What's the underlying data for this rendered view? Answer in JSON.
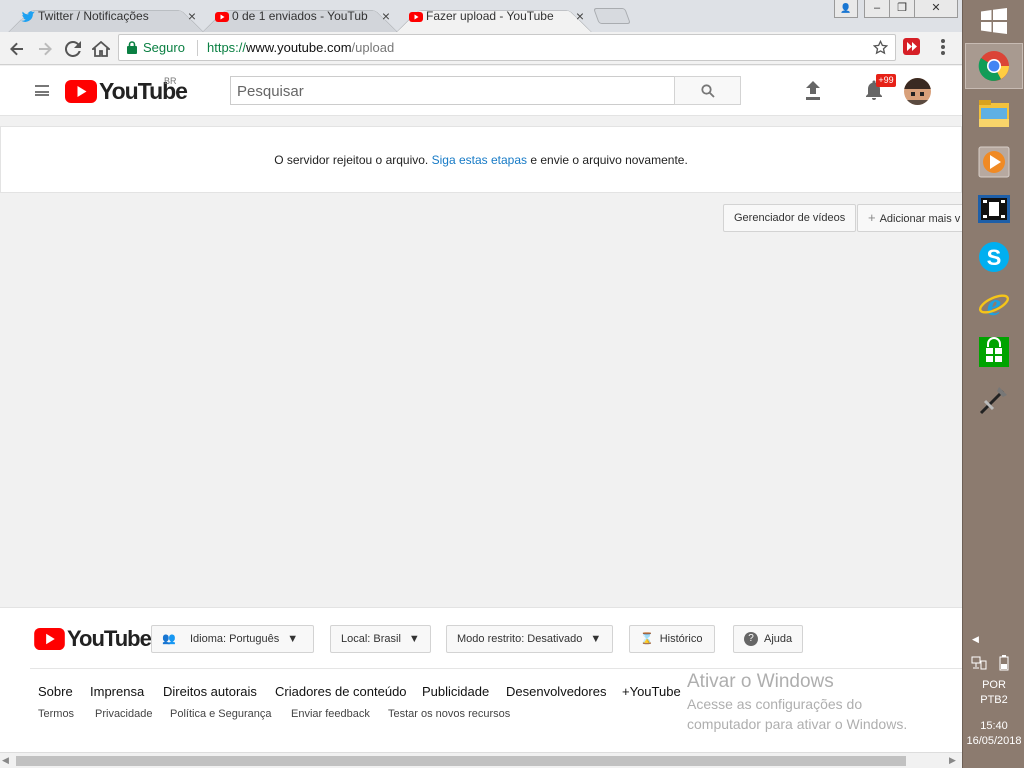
{
  "tabs": [
    {
      "label": "Twitter / Notificações",
      "icon": "twitter-icon",
      "close": "×"
    },
    {
      "label": "0 de 1 enviados - YouTub",
      "icon": "youtube-icon",
      "close": "×"
    },
    {
      "label": "Fazer upload - YouTube",
      "icon": "youtube-icon",
      "close": "×"
    }
  ],
  "window_controls": {
    "minimize": "–",
    "maximize": "❐",
    "close": "✕",
    "profile": "👤"
  },
  "toolbar": {
    "secure_label": "Seguro",
    "url_scheme": "https://",
    "url_host": "www.youtube.com",
    "url_path": "/upload"
  },
  "youtube": {
    "logo_text": "YouTube",
    "region": "BR",
    "search_placeholder": "Pesquisar",
    "notif_count": "+99"
  },
  "message": {
    "before": "O servidor rejeitou o arquivo.",
    "link": "Siga estas etapas",
    "after": "e envie o arquivo novamente."
  },
  "actions": {
    "video_manager": "Gerenciador de vídeos",
    "add_more": "Adicionar mais v"
  },
  "footer": {
    "logo_text": "YouTube",
    "language": "Idioma: Português",
    "location": "Local: Brasil",
    "restricted": "Modo restrito: Desativado",
    "history": "Histórico",
    "help": "Ajuda",
    "links": [
      "Sobre",
      "Imprensa",
      "Direitos autorais",
      "Criadores de conteúdo",
      "Publicidade",
      "Desenvolvedores",
      "+YouTube"
    ],
    "links2": [
      "Termos",
      "Privacidade",
      "Política e Segurança",
      "Enviar feedback",
      "Testar os novos recursos"
    ]
  },
  "watermark": {
    "title": "Ativar o Windows",
    "line1": "Acesse as configurações do",
    "line2": "computador para ativar o Windows."
  },
  "taskbar": {
    "lang": "POR",
    "layout": "PTB2",
    "time": "15:40",
    "date": "16/05/2018",
    "icons": [
      "chrome-icon",
      "file-explorer-icon",
      "media-player-icon",
      "video-editor-icon",
      "skype-icon",
      "internet-explorer-icon",
      "store-icon",
      "tool-icon"
    ]
  },
  "colors": {
    "youtube_red": "#ff0000",
    "link_blue": "#167ac6",
    "secure_green": "#0b8043"
  }
}
